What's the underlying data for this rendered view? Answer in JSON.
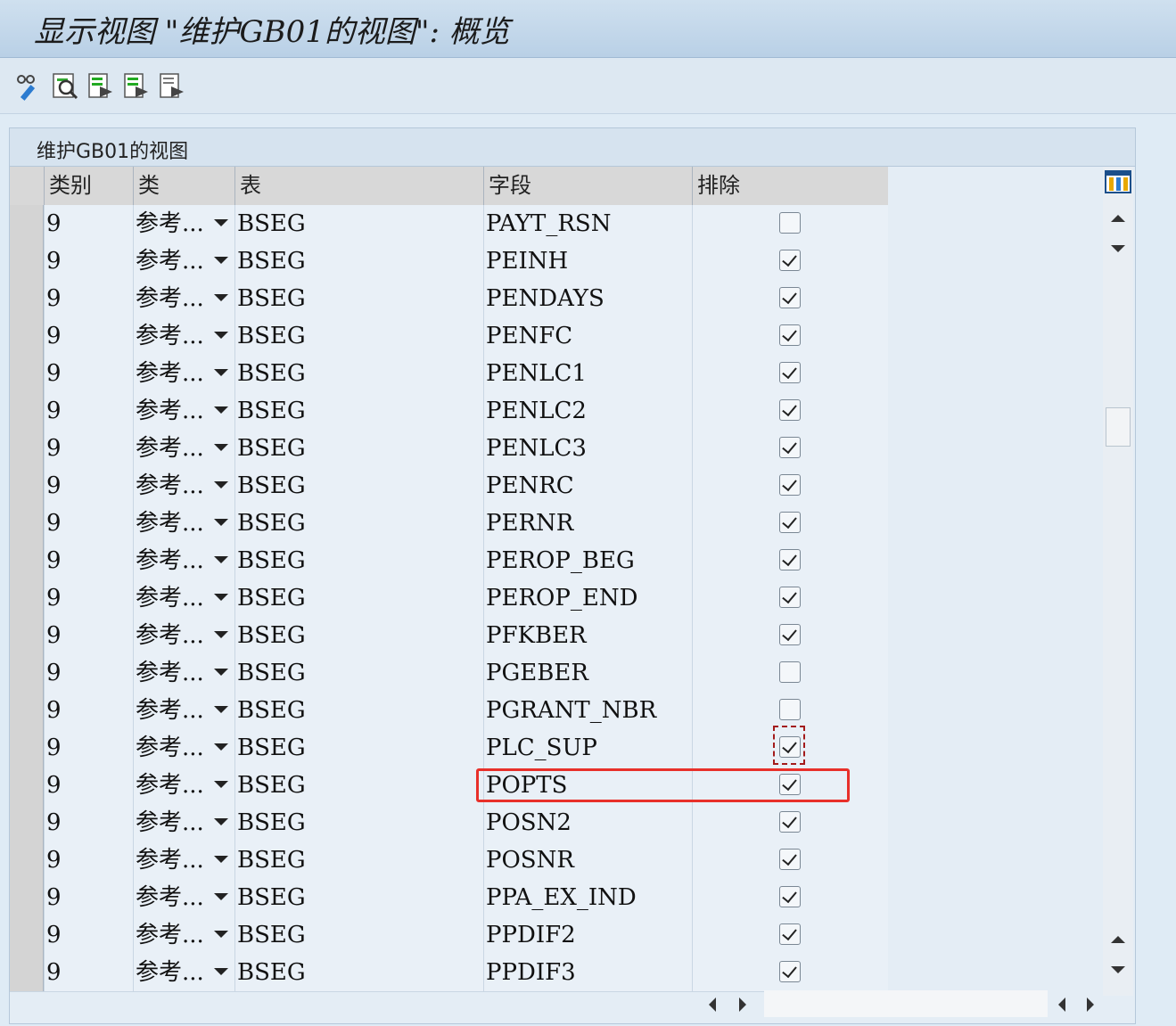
{
  "window": {
    "title": "显示视图 \"维护GB01的视图\": 概览"
  },
  "toolbar": {
    "icons": [
      "display-change-icon",
      "find-icon",
      "export-icon",
      "export-next-icon",
      "export-all-icon"
    ]
  },
  "panel": {
    "title": "维护GB01的视图"
  },
  "table": {
    "headers": {
      "category": "类别",
      "class": "类",
      "table": "表",
      "field": "字段",
      "exclude": "排除"
    },
    "rows": [
      {
        "category": "9",
        "class": "参考...",
        "table": "BSEG",
        "field": "PAYT_RSN",
        "exclude": false
      },
      {
        "category": "9",
        "class": "参考...",
        "table": "BSEG",
        "field": "PEINH",
        "exclude": true
      },
      {
        "category": "9",
        "class": "参考...",
        "table": "BSEG",
        "field": "PENDAYS",
        "exclude": true
      },
      {
        "category": "9",
        "class": "参考...",
        "table": "BSEG",
        "field": "PENFC",
        "exclude": true
      },
      {
        "category": "9",
        "class": "参考...",
        "table": "BSEG",
        "field": "PENLC1",
        "exclude": true
      },
      {
        "category": "9",
        "class": "参考...",
        "table": "BSEG",
        "field": "PENLC2",
        "exclude": true
      },
      {
        "category": "9",
        "class": "参考...",
        "table": "BSEG",
        "field": "PENLC3",
        "exclude": true
      },
      {
        "category": "9",
        "class": "参考...",
        "table": "BSEG",
        "field": "PENRC",
        "exclude": true
      },
      {
        "category": "9",
        "class": "参考...",
        "table": "BSEG",
        "field": "PERNR",
        "exclude": true
      },
      {
        "category": "9",
        "class": "参考...",
        "table": "BSEG",
        "field": "PEROP_BEG",
        "exclude": true
      },
      {
        "category": "9",
        "class": "参考...",
        "table": "BSEG",
        "field": "PEROP_END",
        "exclude": true
      },
      {
        "category": "9",
        "class": "参考...",
        "table": "BSEG",
        "field": "PFKBER",
        "exclude": true
      },
      {
        "category": "9",
        "class": "参考...",
        "table": "BSEG",
        "field": "PGEBER",
        "exclude": false
      },
      {
        "category": "9",
        "class": "参考...",
        "table": "BSEG",
        "field": "PGRANT_NBR",
        "exclude": false
      },
      {
        "category": "9",
        "class": "参考...",
        "table": "BSEG",
        "field": "PLC_SUP",
        "exclude": true
      },
      {
        "category": "9",
        "class": "参考...",
        "table": "BSEG",
        "field": "POPTS",
        "exclude": true
      },
      {
        "category": "9",
        "class": "参考...",
        "table": "BSEG",
        "field": "POSN2",
        "exclude": true
      },
      {
        "category": "9",
        "class": "参考...",
        "table": "BSEG",
        "field": "POSNR",
        "exclude": true
      },
      {
        "category": "9",
        "class": "参考...",
        "table": "BSEG",
        "field": "PPA_EX_IND",
        "exclude": true
      },
      {
        "category": "9",
        "class": "参考...",
        "table": "BSEG",
        "field": "PPDIF2",
        "exclude": true
      },
      {
        "category": "9",
        "class": "参考...",
        "table": "BSEG",
        "field": "PPDIF3",
        "exclude": true
      }
    ]
  },
  "highlight": {
    "row_field": "POPTS",
    "color": "#e8302a"
  },
  "focus": {
    "row_field": "PLC_SUP",
    "column": "exclude"
  },
  "colors": {
    "accent": "#1b6fb5",
    "row_bg": "#e9f0f7"
  }
}
